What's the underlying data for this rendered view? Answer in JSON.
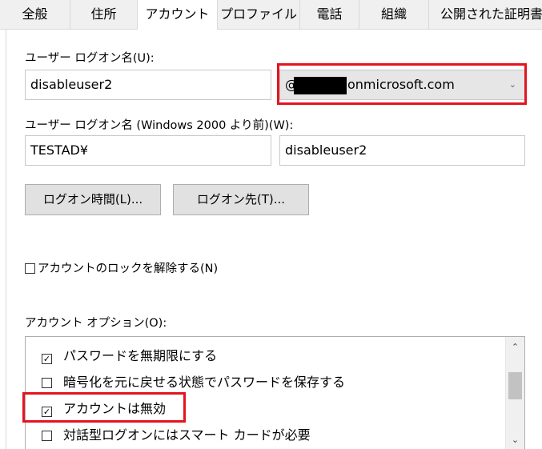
{
  "tabs": [
    {
      "label": "全般"
    },
    {
      "label": "住所"
    },
    {
      "label": "アカウント"
    },
    {
      "label": "プロファイル"
    },
    {
      "label": "電話"
    },
    {
      "label": "組織"
    },
    {
      "label": "公開された証明書"
    }
  ],
  "logon": {
    "label": "ユーザー ログオン名(U):",
    "username": "disableuser2",
    "domain_prefix": "@",
    "domain_suffix": "onmicrosoft.com"
  },
  "pre2000": {
    "label": "ユーザー ログオン名 (Windows 2000 より前)(W):",
    "domain": "TESTAD¥",
    "username": "disableuser2"
  },
  "buttons": {
    "logon_hours": "ログオン時間(L)...",
    "logon_to": "ログオン先(T)..."
  },
  "unlock": {
    "label": "アカウントのロックを解除する(N)",
    "checked": false
  },
  "options": {
    "label": "アカウント オプション(O):",
    "items": [
      {
        "label": "パスワードを無期限にする",
        "checked": true
      },
      {
        "label": "暗号化を元に戻せる状態でパスワードを保存する",
        "checked": false
      },
      {
        "label": "アカウントは無効",
        "checked": true
      },
      {
        "label": "対話型ログオンにはスマート カードが必要",
        "checked": false
      }
    ]
  },
  "icons": {
    "dropdown": "chevron-down-icon",
    "scroll_up": "scroll-up-icon",
    "scroll_down": "scroll-down-icon",
    "check": "checkmark-icon"
  },
  "colors": {
    "highlight": "#e3141f",
    "tab_bar": "#f0f0f0"
  }
}
